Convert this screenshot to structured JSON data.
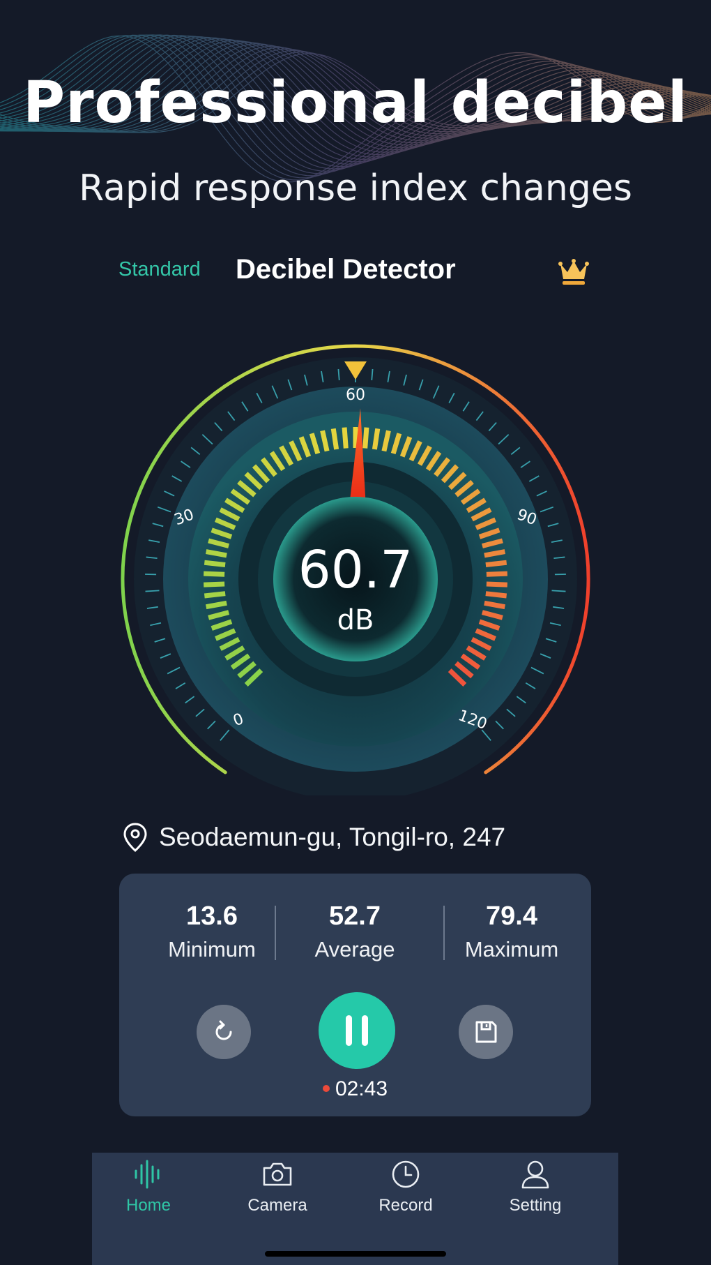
{
  "promo": {
    "headline": "Professional decibel",
    "subline": "Rapid response index changes"
  },
  "header": {
    "mode_label": "Standard",
    "app_title": "Decibel Detector",
    "premium_icon": "crown-icon"
  },
  "gauge": {
    "reading": "60.7",
    "unit": "dB",
    "scale_labels": [
      "0",
      "30",
      "60",
      "90",
      "120"
    ],
    "scale_min": 0,
    "scale_max": 120,
    "needle_value": 60.7,
    "colors": {
      "low": "#8ad24a",
      "mid": "#e8d53e",
      "high": "#f0543c",
      "accent": "#25c9a9"
    }
  },
  "location": {
    "icon": "location-pin-icon",
    "text": "Seodaemun-gu, Tongil-ro, 247"
  },
  "stats": {
    "min_value": "13.6",
    "min_label": "Minimum",
    "avg_value": "52.7",
    "avg_label": "Average",
    "max_value": "79.4",
    "max_label": "Maximum"
  },
  "controls": {
    "reset_icon": "refresh-icon",
    "pause_icon": "pause-icon",
    "save_icon": "save-icon",
    "timer": "02:43"
  },
  "tabs": [
    {
      "label": "Home",
      "icon": "waveform-icon",
      "active": true
    },
    {
      "label": "Camera",
      "icon": "camera-icon",
      "active": false
    },
    {
      "label": "Record",
      "icon": "clock-icon",
      "active": false
    },
    {
      "label": "Setting",
      "icon": "user-icon",
      "active": false
    }
  ]
}
